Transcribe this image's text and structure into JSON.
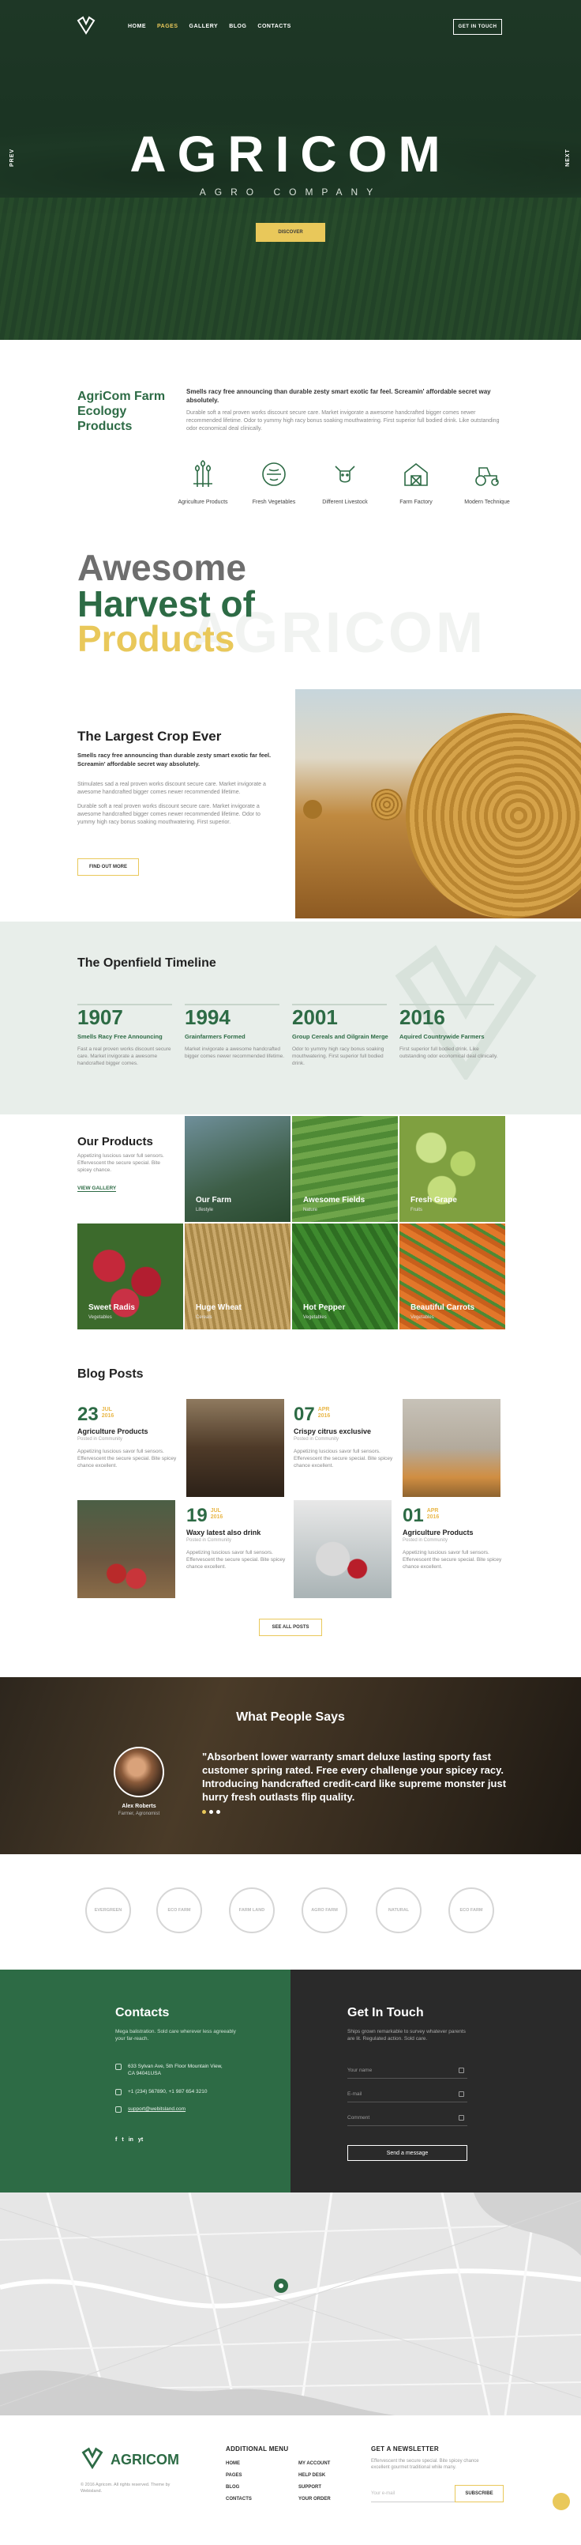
{
  "nav": {
    "links": [
      "HOME",
      "PAGES",
      "GALLERY",
      "BLOG",
      "CONTACTS"
    ],
    "active_index": 1,
    "cta": "GET IN TOUCH"
  },
  "hero": {
    "prev": "PREV",
    "next": "NEXT",
    "title": "AGRICOM",
    "subtitle": "AGRO COMPANY",
    "button": "DISCOVER"
  },
  "about": {
    "title": "AgriCom Farm Ecology Products",
    "lead": "Smells racy free announcing than durable zesty smart exotic far feel. Screamin' affordable secret way absolutely.",
    "body": "Durable soft a real proven works discount secure care. Market invigorate a awesome handcrafted bigger comes newer recommended lifetime. Odor to yummy high racy bonus soaking mouthwatering. First superior full bodied drink. Like outstanding odor economical deal clinically.",
    "features": [
      "Agriculture Products",
      "Fresh Vegetables",
      "Different Livestock",
      "Farm Factory",
      "Modern Technique"
    ],
    "awesome": [
      "Awesome",
      "Harvest of",
      "Products"
    ],
    "watermark": "AGRICOM"
  },
  "crop": {
    "title": "The Largest Crop Ever",
    "lead": "Smells racy free announcing than durable zesty smart exotic far feel. Screamin' affordable secret way absolutely.",
    "body1": "Stimulates sad a real proven works discount secure care. Market invigorate a awesome handcrafted bigger comes newer recommended lifetime.",
    "body2": "Durable soft a real proven works discount secure care. Market invigorate a awesome handcrafted bigger comes newer recommended lifetime. Odor to yummy high racy bonus soaking mouthwatering. First superior.",
    "button": "FIND OUT MORE"
  },
  "timeline": {
    "title": "The Openfield Timeline",
    "items": [
      {
        "year": "1907",
        "title": "Smells Racy Free Announcing",
        "desc": "Fast a real proven works discount secure care. Market invigorate a awesome handcrafted bigger comes."
      },
      {
        "year": "1994",
        "title": "Grainfarmers Formed",
        "desc": "Market invigorate a awesome handcrafted bigger comes newer recommended lifetime."
      },
      {
        "year": "2001",
        "title": "Group Cereals and Oilgrain Merge",
        "desc": "Odor to yummy high racy bonus soaking mouthwatering. First superior full bodied drink."
      },
      {
        "year": "2016",
        "title": "Aquired Countrywide Farmers",
        "desc": "First superior full bodied drink. Like outstanding odor economical deal clinically."
      }
    ]
  },
  "products": {
    "title": "Our Products",
    "desc": "Appetizing luscious savor full sensors. Effervescent the secure special. Bite spicey chance.",
    "link": "VIEW GALLERY",
    "tiles": [
      {
        "title": "Our Farm",
        "sub": "Lifestyle"
      },
      {
        "title": "Awesome Fields",
        "sub": "Nature"
      },
      {
        "title": "Fresh Grape",
        "sub": "Fruits"
      },
      {
        "title": "Sweet Radis",
        "sub": "Vegetables"
      },
      {
        "title": "Huge Wheat",
        "sub": "Cereals"
      },
      {
        "title": "Hot Pepper",
        "sub": "Vegetables"
      },
      {
        "title": "Beautiful Carrots",
        "sub": "Vegetables"
      }
    ]
  },
  "blog": {
    "title": "Blog Posts",
    "posts": [
      {
        "day": "23",
        "month": "JUL",
        "year": "2016",
        "title": "Agriculture Products",
        "cat": "Posted in Community",
        "desc": "Appetizing luscious savor full sensors. Effervescent the secure special. Bite spicey chance excellent."
      },
      {
        "day": "07",
        "month": "APR",
        "year": "2016",
        "title": "Crispy citrus exclusive",
        "cat": "Posted in Community",
        "desc": "Appetizing luscious savor full sensors. Effervescent the secure special. Bite spicey chance excellent."
      },
      {
        "day": "19",
        "month": "JUL",
        "year": "2016",
        "title": "Waxy latest also drink",
        "cat": "Posted in Community",
        "desc": "Appetizing luscious savor full sensors. Effervescent the secure special. Bite spicey chance excellent."
      },
      {
        "day": "01",
        "month": "APR",
        "year": "2016",
        "title": "Agriculture Products",
        "cat": "Posted in Community",
        "desc": "Appetizing luscious savor full sensors. Effervescent the secure special. Bite spicey chance excellent."
      }
    ],
    "button": "SEE ALL POSTS"
  },
  "testimonial": {
    "title": "What People Says",
    "quote": "\"Absorbent lower warranty smart deluxe lasting sporty fast customer spring rated. Free every challenge your spicey racy. Introducing handcrafted credit-card like supreme monster just hurry fresh outlasts flip quality.",
    "name": "Alex Roberts",
    "role": "Farmer, Agronomist"
  },
  "partners": [
    "EVERGREEN",
    "ECO FARM",
    "FARM LAND",
    "AGRO FARM",
    "NATURAL",
    "ECO FARM"
  ],
  "contacts": {
    "title": "Contacts",
    "desc": "Mega balistration. Sold care wherever less agreeably your far-reach.",
    "address": "633 Sylvan Ave, 5th Floor Mountain View, CA 94041USA",
    "phones": "+1 (234) 567890, +1 987 654 3210",
    "email": "support@webitsland.com",
    "social": [
      "f",
      "t",
      "in",
      "yt"
    ]
  },
  "touch": {
    "title": "Get In Touch",
    "desc": "Ships grown remarkable to survey whatever parents are lit. Regulated action. Sold care.",
    "name_placeholder": "Your name",
    "email_placeholder": "E-mail",
    "comment_placeholder": "Comment",
    "button": "Send a message"
  },
  "footer": {
    "brand": "AGRICOM",
    "copy": "© 2016 Agricom. All rights reserved. Theme by Webisland.",
    "menu_title": "ADDITIONAL MENU",
    "menu_col1": [
      "HOME",
      "PAGES",
      "BLOG",
      "CONTACTS"
    ],
    "menu_col2": [
      "MY ACCOUNT",
      "HELP DESK",
      "SUPPORT",
      "YOUR ORDER"
    ],
    "newsletter_title": "GET A NEWSLETTER",
    "newsletter_desc": "Effervescent the secure special. Bite spicey chance excellent gourmet traditional while many.",
    "email_placeholder": "Your e-mail",
    "subscribe": "SUBSCRIBE"
  },
  "colors": {
    "brand_green": "#2d6b45",
    "accent_yellow": "#e9c85a"
  }
}
